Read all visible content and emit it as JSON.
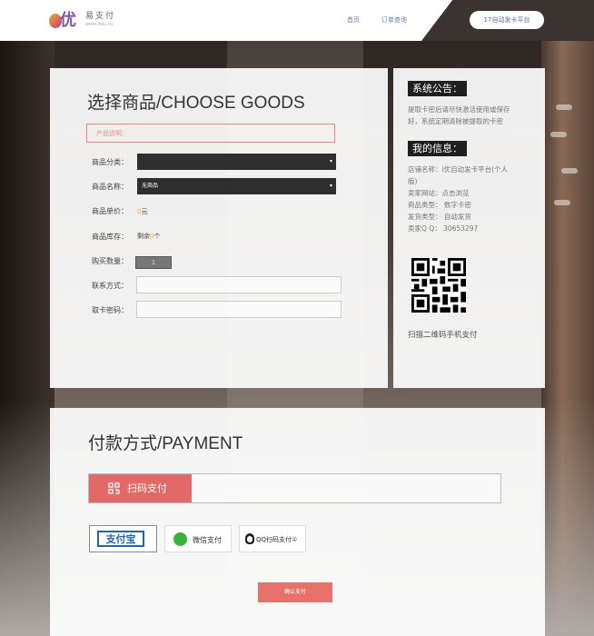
{
  "header": {
    "logo_name": "易支付",
    "logo_sub": "www.ilisu.ru",
    "nav_home": "首页",
    "nav_orders": "订单查询",
    "platform_btn": "17自动发卡平台"
  },
  "goods": {
    "title": "选择商品/CHOOSE GOODS",
    "description_label": "产品说明：",
    "category_label": "商品分类：",
    "category_value": "",
    "name_label": "商品名称：",
    "name_value": "无商品",
    "price_label": "商品单价：",
    "price_value": "0",
    "price_unit": "元",
    "stock_label": "商品库存：",
    "stock_prefix": "剩余",
    "stock_value": "0",
    "stock_unit": "个",
    "qty_label": "购买数量：",
    "qty_value": "1",
    "contact_label": "联系方式：",
    "password_label": "取卡密码："
  },
  "side": {
    "announce_title": "系统公告：",
    "announce_line1": "提取卡密后请尽快激活使用或保存",
    "announce_line2": "好，系统定期清除被提取的卡密",
    "info_title": "我的信息：",
    "info_lines": [
      "店铺名称：i优自动发卡平台(个人",
      "版)",
      "卖家网站：点击浏览",
      "商品类型：  数字卡密",
      "发货类型：  自动发货",
      "卖家Q Q：  30653297"
    ],
    "scan_text": "扫描二维码手机支付"
  },
  "payment": {
    "title": "付款方式/PAYMENT",
    "tab_scan": "扫码支付",
    "alipay": "支付宝",
    "wechat": "微信支付",
    "qqpay": "QQ扫码支付①",
    "confirm": "确认支付"
  },
  "colors": {
    "accent": "#e26a66",
    "nav_link": "#6a7ea8",
    "highlight": "#f0a040"
  }
}
